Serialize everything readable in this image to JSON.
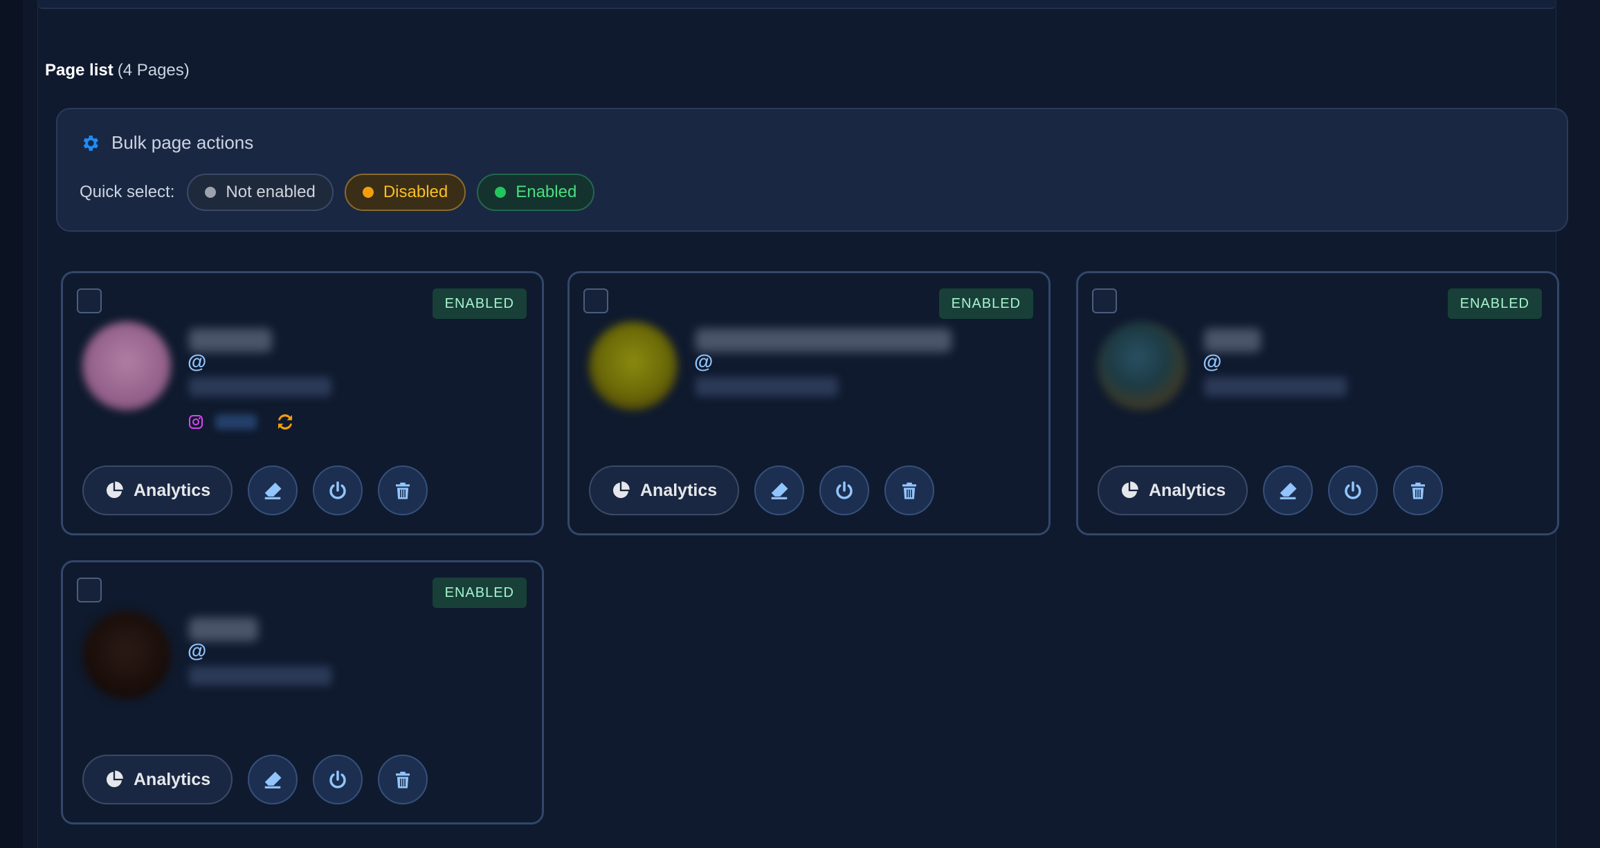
{
  "page_list": {
    "title": "Page list",
    "count_label": "(4 Pages)"
  },
  "bulk": {
    "title": "Bulk page actions",
    "quick_select_label": "Quick select:",
    "chips": [
      {
        "label": "Not enabled",
        "color": "#9ca3af"
      },
      {
        "label": "Disabled",
        "color": "#f59e0b"
      },
      {
        "label": "Enabled",
        "color": "#22c55e"
      }
    ]
  },
  "cards": [
    {
      "status": "ENABLED",
      "at_symbol": "@",
      "analytics_label": "Analytics",
      "has_instagram": true
    },
    {
      "status": "ENABLED",
      "at_symbol": "@",
      "analytics_label": "Analytics",
      "has_instagram": false
    },
    {
      "status": "ENABLED",
      "at_symbol": "@",
      "analytics_label": "Analytics",
      "has_instagram": false
    },
    {
      "status": "ENABLED",
      "at_symbol": "@",
      "analytics_label": "Analytics",
      "has_instagram": false
    }
  ],
  "icons": {
    "gear": "gear-icon",
    "analytics": "pie-chart-icon",
    "erase": "eraser-icon",
    "power": "power-icon",
    "delete": "trash-icon",
    "instagram": "instagram-icon",
    "sync": "sync-icon"
  },
  "colors": {
    "accent_blue": "#1d8cf8",
    "enabled_badge_bg": "#184038",
    "at_color": "#93c5fd",
    "instagram": "#d946ef",
    "sync": "#f59e0b"
  }
}
